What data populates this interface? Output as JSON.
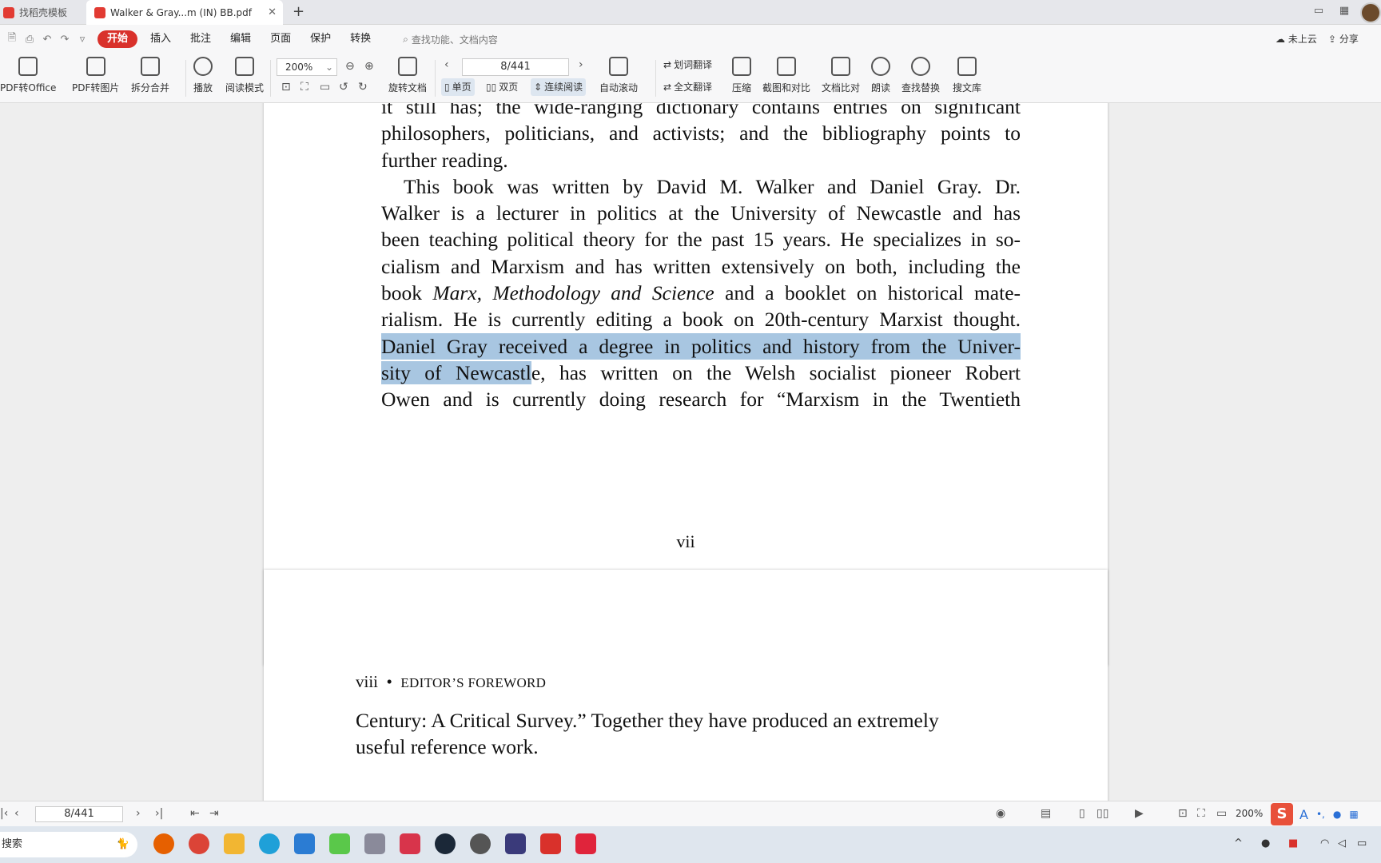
{
  "tabs": [
    {
      "label": "找稻壳模板"
    },
    {
      "label": "Walker & Gray...m (IN) BB.pdf"
    }
  ],
  "menu": {
    "items": [
      "开始",
      "插入",
      "批注",
      "编辑",
      "页面",
      "保护",
      "转换"
    ],
    "search_placeholder": "查找功能、文档内容",
    "cloud": "未上云",
    "share": "分享"
  },
  "ribbon": {
    "pdf_to_office": "PDF转Office",
    "pdf_to_image": "PDF转图片",
    "split_merge": "拆分合并",
    "play": "播放",
    "read_mode": "阅读模式",
    "zoom": "200%",
    "rotate": "旋转文档",
    "page": "8/441",
    "single": "单页",
    "double": "双页",
    "continuous": "连续阅读",
    "autoscroll": "自动滚动",
    "translate_word": "划词翻译",
    "translate_all": "全文翻译",
    "compress": "压缩",
    "screenshot_compare": "截图和对比",
    "doc_compare": "文档比对",
    "read_aloud": "朗读",
    "find_replace": "查找替换",
    "library": "搜文库"
  },
  "document": {
    "page1_lines": [
      "it still has; the wide-ranging dictionary contains entries on significant",
      "philosophers, politicians, and activists; and the bibliography points to",
      "further reading.",
      "This book was written by David M. Walker and Daniel Gray. Dr.",
      "Walker is a lecturer in politics at the University of Newcastle and has",
      "been teaching political theory for the past 15 years. He specializes in so-",
      "cialism and Marxism and has written extensively on both, including the",
      "book",
      "Marx, Methodology and Science",
      "and a booklet on historical mate-",
      "rialism. He is currently editing a book on 20th-century Marxist thought.",
      "Daniel Gray received a degree in politics and history from the Univer-",
      "sity of Newcastl",
      "e, has written on the Welsh socialist pioneer Robert",
      "Owen and is currently doing research for “Marxism in the Twentieth"
    ],
    "folio": "vii",
    "page2_folio": "viii",
    "page2_bullet": "•",
    "running_head": "EDITOR’S FOREWORD",
    "page2_lines": [
      "Century: A Critical Survey.” Together they have produced an extremely",
      "useful reference work."
    ]
  },
  "statusbar": {
    "page": "8/441",
    "zoom": "200%"
  },
  "taskbar": {
    "search": "搜索"
  }
}
